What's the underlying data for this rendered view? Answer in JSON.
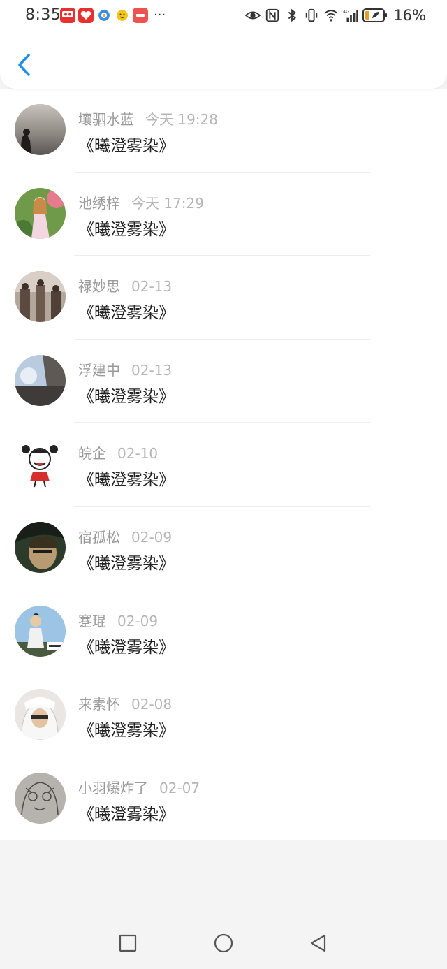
{
  "status_bar": {
    "time": "8:35",
    "battery_percent": "16%",
    "network_label": "4G",
    "more_indicator": "···"
  },
  "header": {
    "back_icon": "chevron-left-icon"
  },
  "comments": [
    {
      "name": "壤驷水蓝",
      "date": "今天 19:28",
      "message": "《曦澄雾染》",
      "avatar": "avatar-silhouette-sunset"
    },
    {
      "name": "池绣梓",
      "date": "今天 17:29",
      "message": "《曦澄雾染》",
      "avatar": "avatar-girl-garden"
    },
    {
      "name": "禄妙思",
      "date": "02-13",
      "message": "《曦澄雾染》",
      "avatar": "avatar-street-scene"
    },
    {
      "name": "浮建中",
      "date": "02-13",
      "message": "《曦澄雾染》",
      "avatar": "avatar-sky-photo"
    },
    {
      "name": "皖企",
      "date": "02-10",
      "message": "《曦澄雾染》",
      "avatar": "avatar-cartoon-girl"
    },
    {
      "name": "宿孤松",
      "date": "02-09",
      "message": "《曦澄雾染》",
      "avatar": "avatar-man-closeup"
    },
    {
      "name": "蹇琨",
      "date": "02-09",
      "message": "《曦澄雾染》",
      "avatar": "avatar-boy-outdoor"
    },
    {
      "name": "来素怀",
      "date": "02-08",
      "message": "《曦澄雾染》",
      "avatar": "avatar-white-hoodie"
    },
    {
      "name": "小羽爆炸了",
      "date": "02-07",
      "message": "《曦澄雾染》",
      "avatar": "avatar-sketch-drawing"
    }
  ],
  "nav_bar": {
    "recents_icon": "square-icon",
    "home_icon": "circle-icon",
    "back_icon": "triangle-back-icon"
  },
  "colors": {
    "accent": "#1e90e8",
    "name_text": "#9a9a9a",
    "date_text": "#b5b5b5",
    "message_text": "#222222",
    "background": "#f4f4f4"
  }
}
